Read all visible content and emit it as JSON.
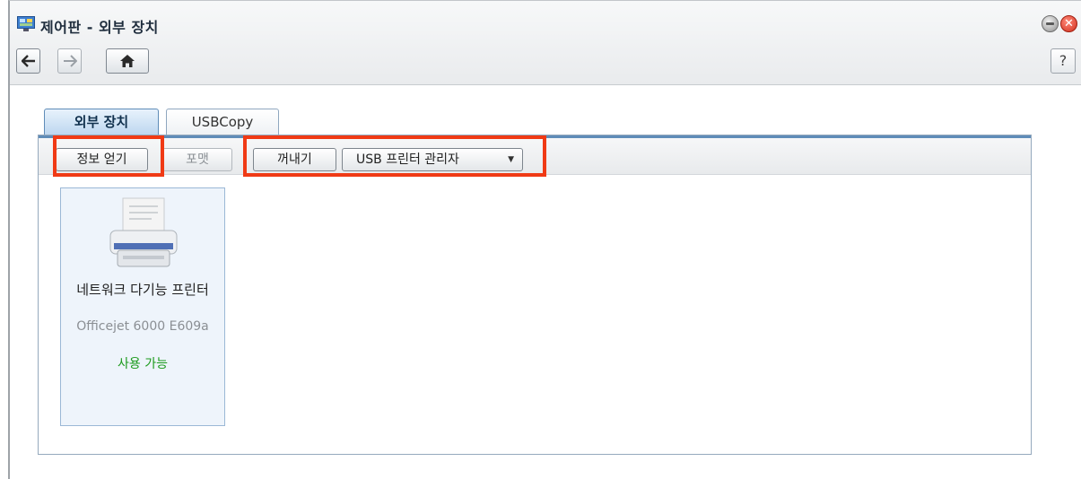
{
  "window": {
    "title": "제어판 - 외부 장치",
    "app_icon": "control-panel-icon",
    "minimize_icon": "minimize-icon",
    "close_glyph": "✕"
  },
  "nav": {
    "back_glyph": "🡐",
    "forward_glyph": "→",
    "home_glyph": "⌂",
    "help_label": "?"
  },
  "tabs": [
    {
      "label": "외부 장치",
      "active": true
    },
    {
      "label": "USBCopy",
      "active": false
    }
  ],
  "toolbar": {
    "info_label": "정보 얻기",
    "format_label": "포맷",
    "eject_label": "꺼내기",
    "usb_printer_label": "USB 프린터 관리자",
    "usb_printer_caret": "▼"
  },
  "devices": [
    {
      "name": "네트워크 다기능 프린터",
      "model": "Officejet 6000 E609a",
      "status": "사용 가능",
      "icon": "printer-icon"
    }
  ],
  "colors": {
    "highlight": "#f03a15",
    "status_ok": "#1b9a1b",
    "accent": "#5f8cb8"
  }
}
